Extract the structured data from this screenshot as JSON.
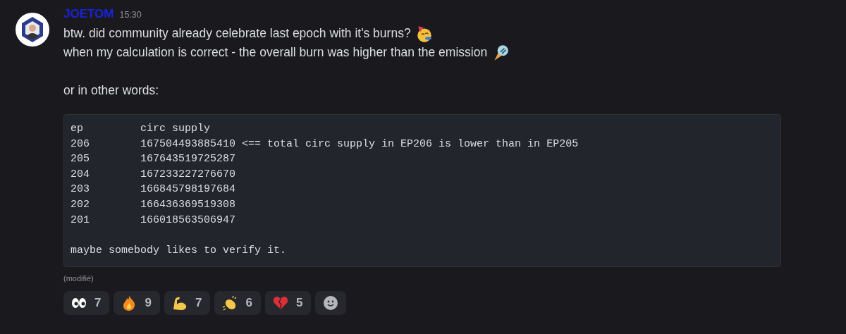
{
  "message": {
    "author": "JOETOM",
    "time": "15:30",
    "lines": [
      {
        "kind": "party-face",
        "text": "btw. did community already celebrate last epoch with it's burns?"
      },
      {
        "kind": "rocket",
        "text": "when my calculation is correct - the overall burn was higher than the emission"
      },
      {
        "kind": "blank"
      },
      {
        "kind": "plain",
        "text": "or in other words:"
      }
    ],
    "code_lines": [
      {
        "kind": "row",
        "text": "ep\tcirc supply"
      },
      {
        "kind": "row",
        "text": "206\t167504493885410 <== total circ supply in EP206 is lower than in EP205"
      },
      {
        "kind": "row",
        "text": "205\t167643519725287"
      },
      {
        "kind": "row",
        "text": "204\t167233227276670"
      },
      {
        "kind": "row",
        "text": "203\t166845798197684"
      },
      {
        "kind": "row",
        "text": "202\t166436369519308"
      },
      {
        "kind": "row",
        "text": "201\t166018563506947"
      },
      {
        "kind": "blank"
      },
      {
        "kind": "row",
        "text": "maybe somebody likes to verify it."
      }
    ],
    "edited_label": "(modifié)",
    "reactions": [
      {
        "kind": "eyes",
        "count": "7"
      },
      {
        "kind": "fire",
        "count": "9"
      },
      {
        "kind": "muscle",
        "count": "7"
      },
      {
        "kind": "clap",
        "count": "6"
      },
      {
        "kind": "broken-heart",
        "count": "5"
      }
    ]
  }
}
